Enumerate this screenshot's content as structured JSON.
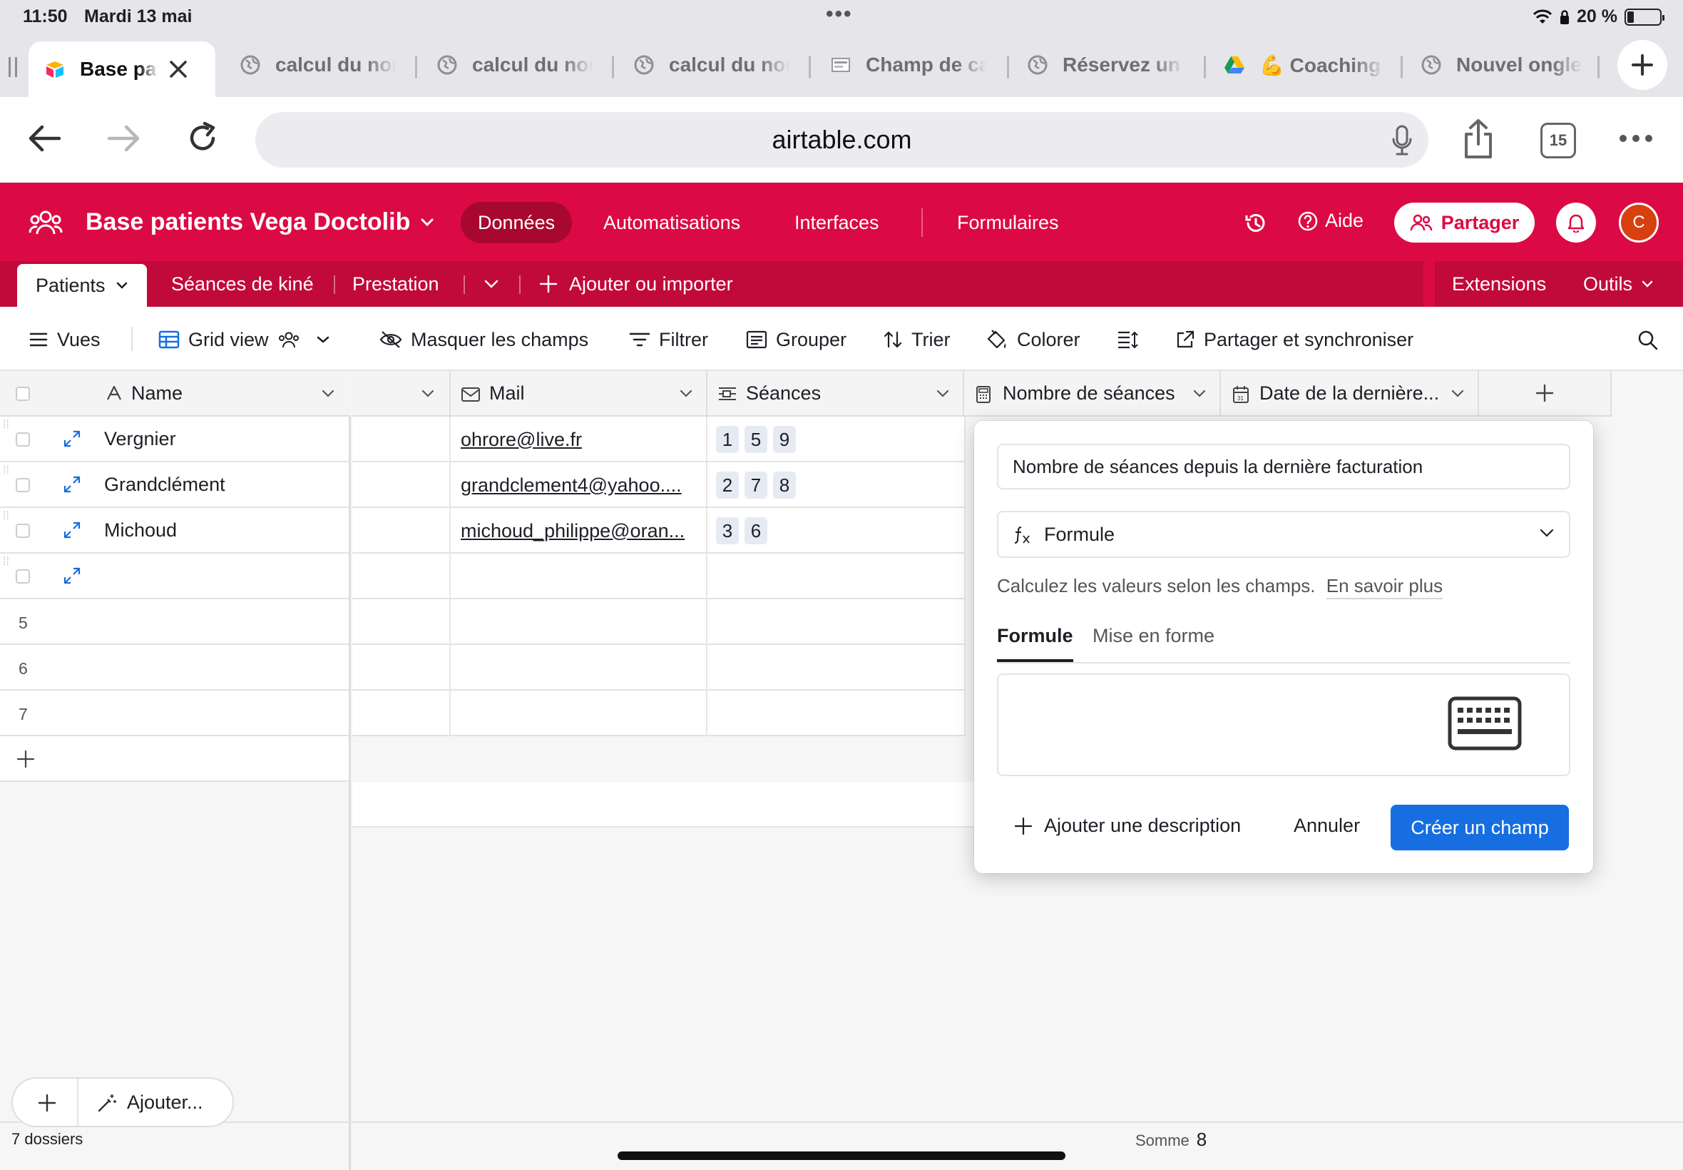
{
  "status_bar": {
    "time": "11:50",
    "date": "Mardi 13 mai",
    "battery": "20 %",
    "battery_level": 0.2
  },
  "browser": {
    "tabs": [
      {
        "label": "Base patients Vega Doctolib",
        "icon": "airtable-logo-icon",
        "active": true
      },
      {
        "label": "calcul du nombre",
        "icon": "globe-icon"
      },
      {
        "label": "calcul du nombre",
        "icon": "globe-icon"
      },
      {
        "label": "calcul du nombre",
        "icon": "globe-icon"
      },
      {
        "label": "Champ de calcul",
        "icon": "page-icon"
      },
      {
        "label": "Réservez un",
        "icon": "globe-icon"
      },
      {
        "label": "💪 Coaching",
        "icon": "google-drive-icon"
      },
      {
        "label": "Nouvel onglet",
        "icon": "globe-icon"
      }
    ],
    "url": "airtable.com",
    "tab_count": "15"
  },
  "app": {
    "base_title": "Base patients Vega Doctolib",
    "nav": [
      "Données",
      "Automatisations",
      "Interfaces",
      "Formulaires"
    ],
    "help": "Aide",
    "share": "Partager",
    "avatar_initial": "C",
    "accent": "#dc0a44"
  },
  "table_tabs": {
    "tabs": [
      "Patients",
      "Séances de kiné",
      "Prestation"
    ],
    "add": "Ajouter ou importer",
    "extensions": "Extensions",
    "tools": "Outils"
  },
  "toolbar": {
    "views": "Vues",
    "view_name": "Grid view",
    "hide_fields": "Masquer les champs",
    "filter": "Filtrer",
    "group": "Grouper",
    "sort": "Trier",
    "color": "Colorer",
    "share_sync": "Partager et synchroniser"
  },
  "grid": {
    "columns": {
      "name": "Name",
      "mail": "Mail",
      "seances": "Séances",
      "nombre": "Nombre de séances",
      "date": "Date de la dernière..."
    },
    "rows": [
      {
        "name": "Vergnier",
        "mail": "ohrore@live.fr",
        "seances": [
          "1",
          "5",
          "9"
        ]
      },
      {
        "name": "Grandclément",
        "mail": "grandclement4@yahoo....",
        "seances": [
          "2",
          "7",
          "8"
        ]
      },
      {
        "name": "Michoud",
        "mail": "michoud_philippe@oran...",
        "seances": [
          "3",
          "6"
        ]
      }
    ],
    "empty_rows": [
      "5",
      "6",
      "7"
    ],
    "footer_count": "7 dossiers",
    "sum_label": "Somme",
    "sum_value": "8",
    "add_label": "Ajouter..."
  },
  "popover": {
    "field_name": "Nombre de séances depuis la dernière facturation",
    "field_type": "Formule",
    "description": "Calculez les valeurs selon les champs.",
    "learn_more": "En savoir plus",
    "tab_formula": "Formule",
    "tab_format": "Mise en forme",
    "add_description": "Ajouter une description",
    "cancel": "Annuler",
    "create": "Créer un champ",
    "create_color": "#166ee1"
  }
}
